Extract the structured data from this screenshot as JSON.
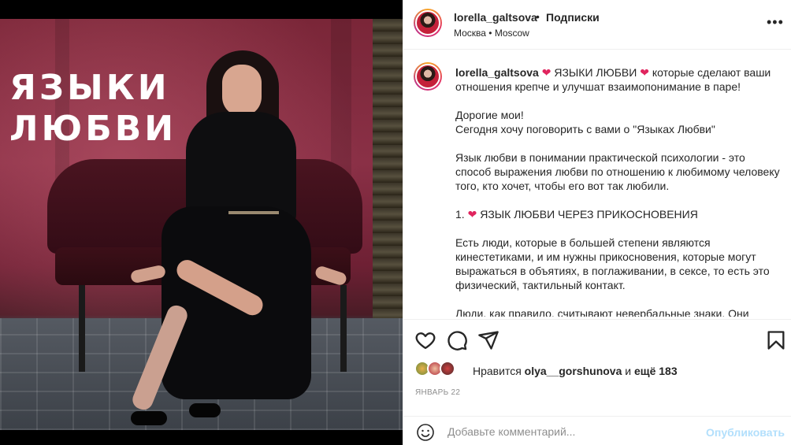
{
  "image": {
    "overlay_title": [
      "ЯЗЫКИ",
      "ЛЮБВИ"
    ]
  },
  "header": {
    "username": "lorella_galtsova",
    "separator": "•",
    "follow_label": "Подписки",
    "location": "Москва • Moscow",
    "more_icon": "more-horizontal-icon"
  },
  "caption": {
    "username": "lorella_galtsova",
    "intro_title": "ЯЗЫКИ ЛЮБВИ",
    "intro_rest": "которые сделают ваши отношения крепче и улучшат взаимопонимание в паре!",
    "greeting": "Дорогие мои!",
    "line2": "Сегодня хочу поговорить с вами о \"Языках Любви\"",
    "para2": "Язык любви в понимании практической психологии - это способ выражения любви по отношению к любимому человеку того, кто хочет, чтобы его вот так любили.",
    "item1_num": "1.",
    "item1_title": "ЯЗЫК ЛЮБВИ ЧЕРЕЗ ПРИКОСНОВЕНИЯ",
    "para3": "Есть люди, которые в большей степени являются кинестетиками, и им нужны прикосновения, которые могут выражаться в объятиях, в поглаживании, в сексе, то есть это физический, тактильный контакт.",
    "para4": "Люди, как правило, считывают невербальные знаки. Они"
  },
  "actions": {
    "like_icon": "heart-icon",
    "comment_icon": "comment-icon",
    "share_icon": "share-icon",
    "save_icon": "bookmark-icon"
  },
  "likes": {
    "prefix": "Нравится",
    "user": "olya__gorshunova",
    "conj": "и",
    "others": "ещё 183"
  },
  "date": "ЯНВАРЬ 22",
  "comment": {
    "emoji_icon": "smiley-icon",
    "placeholder": "Добавьте комментарий...",
    "publish_label": "Опубликовать"
  },
  "colors": {
    "heart": "#e0245e",
    "publish": "#b2dffc",
    "muted": "#8e8e8e",
    "text": "#262626"
  }
}
